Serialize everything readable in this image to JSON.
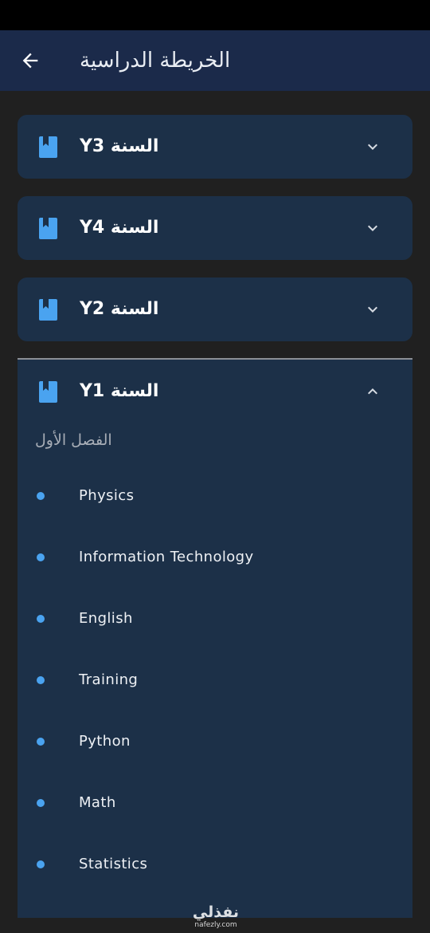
{
  "app_bar": {
    "title": "الخريطة الدراسية",
    "back_icon": "arrow-left-icon",
    "color": "#1b2a4a"
  },
  "years": [
    {
      "label": "Y3 السنة",
      "expanded": false
    },
    {
      "label": "Y4 السنة",
      "expanded": false
    },
    {
      "label": "Y2 السنة",
      "expanded": false
    },
    {
      "label": "Y1 السنة",
      "expanded": true
    }
  ],
  "expanded_year": {
    "semester_title": "الفصل الأول",
    "subjects": [
      "Physics",
      "Information Technology",
      "English",
      "Training",
      "Python",
      "Math",
      "Statistics"
    ]
  },
  "watermark": {
    "logo": "نفذلي",
    "domain": "nafezly.com"
  },
  "colors": {
    "background": "#202020",
    "card": "#1c3048",
    "accent": "#4aa3f0",
    "icon_color": "#4aa3f0"
  }
}
